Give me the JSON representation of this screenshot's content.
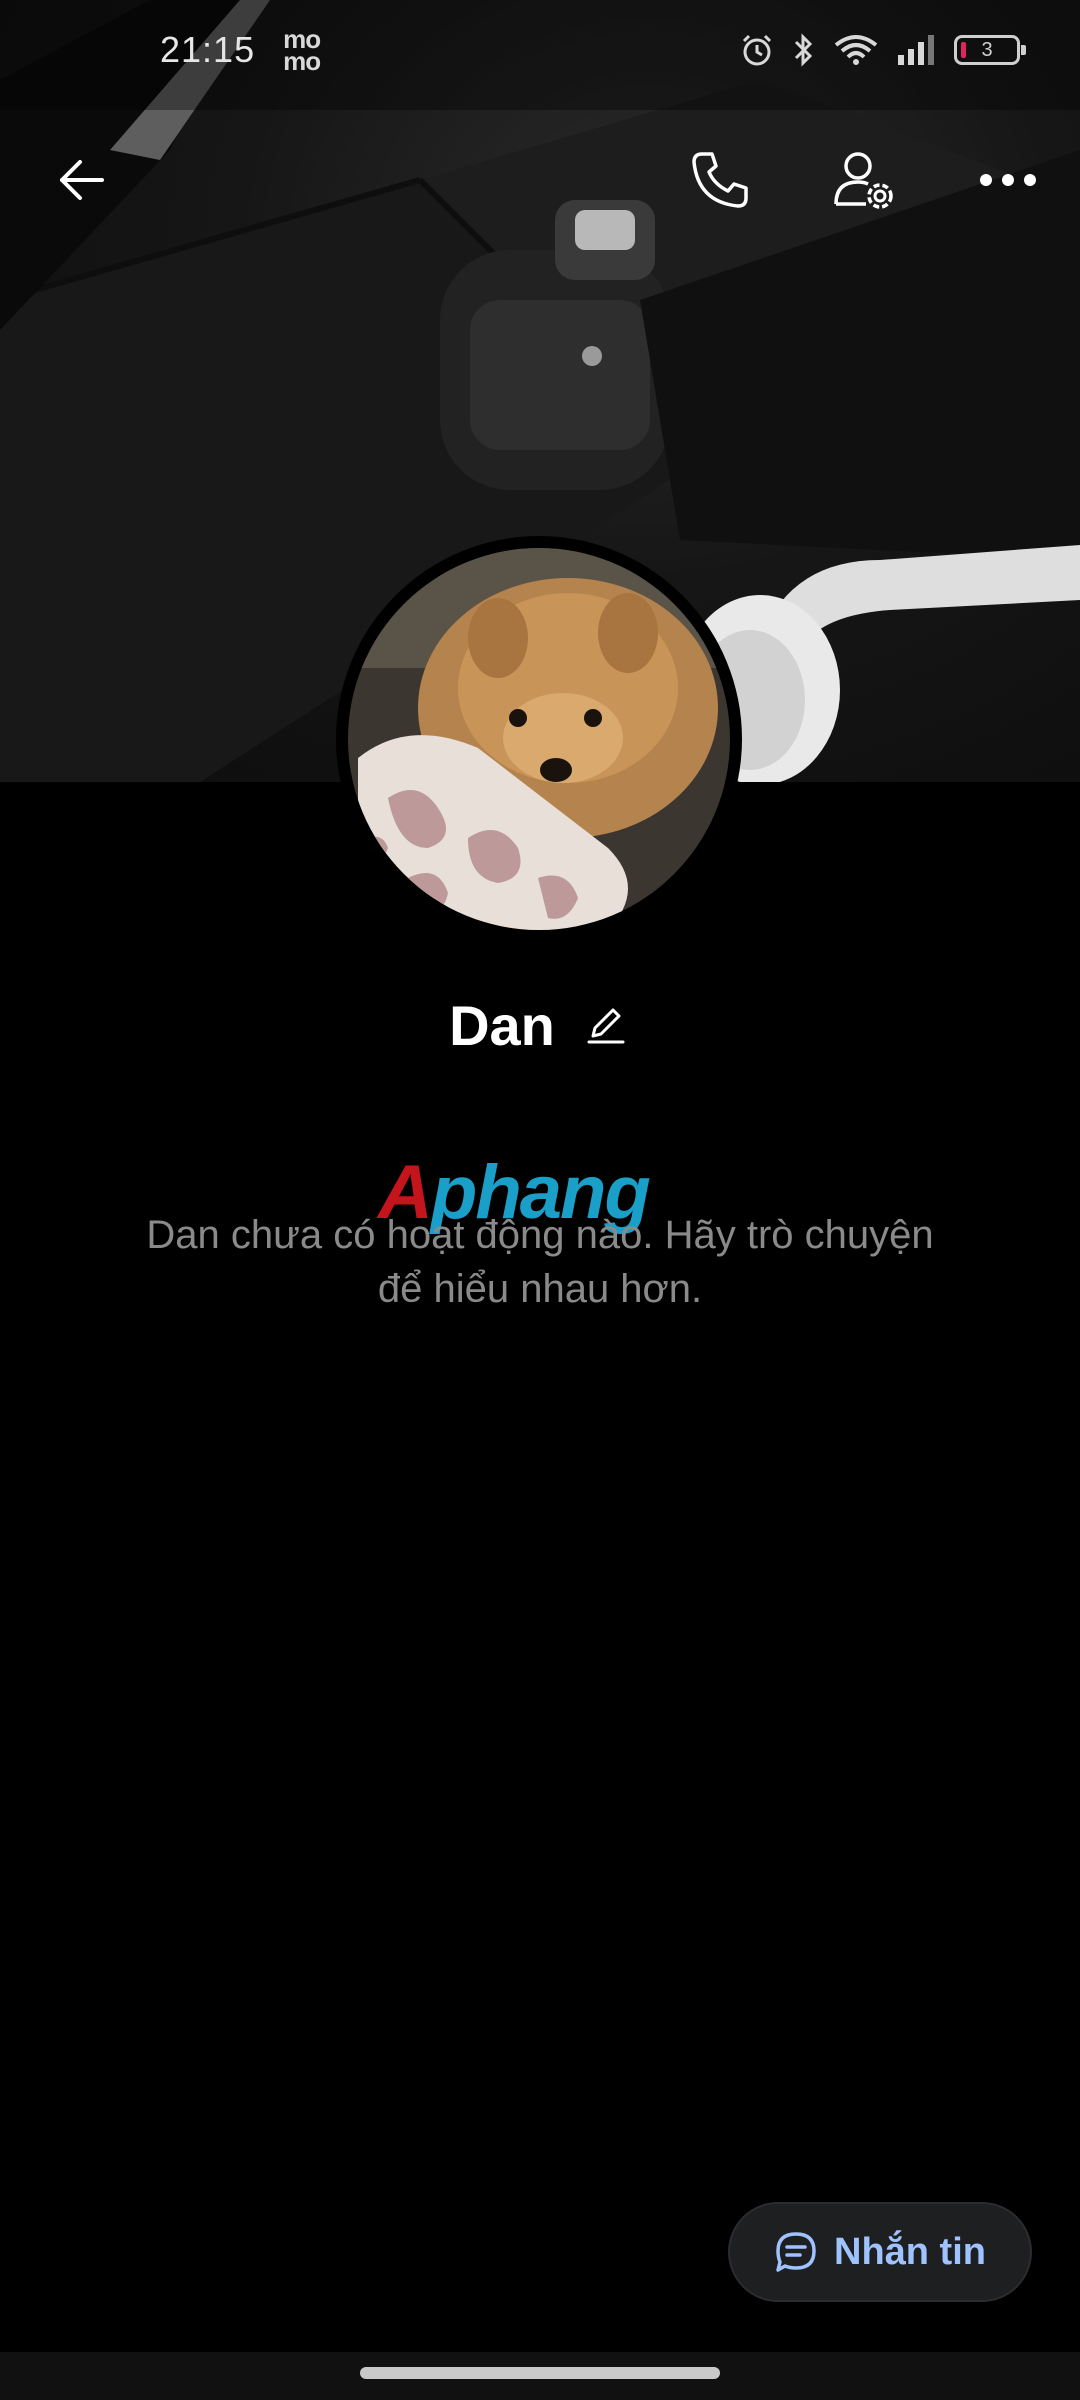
{
  "status_bar": {
    "time": "21:15",
    "carrier_label": "mo mo",
    "battery_level": "3",
    "icons": [
      "alarm-icon",
      "bluetooth-icon",
      "wifi-icon",
      "signal-icon",
      "battery-icon"
    ]
  },
  "top_nav": {
    "back_icon": "arrow-left-icon",
    "call_icon": "phone-icon",
    "settings_icon": "user-settings-icon",
    "more_icon": "more-horizontal-icon"
  },
  "profile": {
    "name": "Dan",
    "edit_icon": "pencil-icon"
  },
  "watermark": {
    "first": "A",
    "rest": "phang"
  },
  "empty_state": {
    "message": "Dan chưa có hoạt động nào. Hãy trò chuyện để hiểu nhau hơn."
  },
  "message_button": {
    "label": "Nhắn tin",
    "icon": "chat-bubble-icon"
  },
  "colors": {
    "background": "#000000",
    "accent": "#9ec3ff",
    "muted_text": "#8a8a8a",
    "button_bg": "#1e1f21"
  }
}
